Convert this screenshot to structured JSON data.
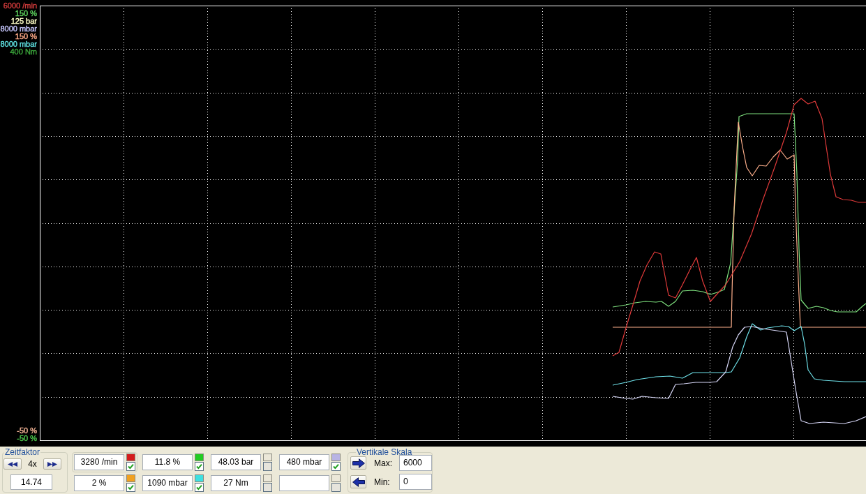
{
  "plot": {
    "scale_max_labels": [
      {
        "text": "6000 /min",
        "color": "#d23c3c"
      },
      {
        "text": "150 %",
        "color": "#5ed25e"
      },
      {
        "text": "125 bar",
        "color": "#ffffc8"
      },
      {
        "text": "8000 mbar",
        "color": "#c8c8ff"
      },
      {
        "text": "150 %",
        "color": "#ffaa88"
      },
      {
        "text": "8000 mbar",
        "color": "#5ee0e0"
      },
      {
        "text": "400 Nm",
        "color": "#3ca83c"
      }
    ],
    "scale_min_labels": [
      {
        "text": "-50 %",
        "color": "#f4b496"
      },
      {
        "text": "-50 %",
        "color": "#4ec84e"
      }
    ]
  },
  "time_factor": {
    "title": "Zeitfaktor",
    "factor": "4x",
    "value": "14.74"
  },
  "channels": [
    {
      "value": "3280 /min",
      "color": "#d41c1c",
      "checked": true,
      "selected": true
    },
    {
      "value": "11.8 %",
      "color": "#22cc22",
      "checked": true,
      "selected": false
    },
    {
      "value": "48.03 bar",
      "color": "#ebe7d8",
      "checked": false,
      "selected": false
    },
    {
      "value": "480 mbar",
      "color": "#b8b4e4",
      "checked": true,
      "selected": false
    },
    {
      "value": "2 %",
      "color": "#f0a020",
      "checked": true,
      "selected": false
    },
    {
      "value": "1090 mbar",
      "color": "#3ee0e0",
      "checked": true,
      "selected": false
    },
    {
      "value": "27 Nm",
      "color": "#ebe7d8",
      "checked": false,
      "selected": false
    },
    {
      "color": "#ebe7d8",
      "checked": false,
      "selected": false
    }
  ],
  "vertical_scale": {
    "title": "Vertikale Skala",
    "max_label": "Max:",
    "max_value": "6000",
    "min_label": "Min:",
    "min_value": "0"
  }
}
